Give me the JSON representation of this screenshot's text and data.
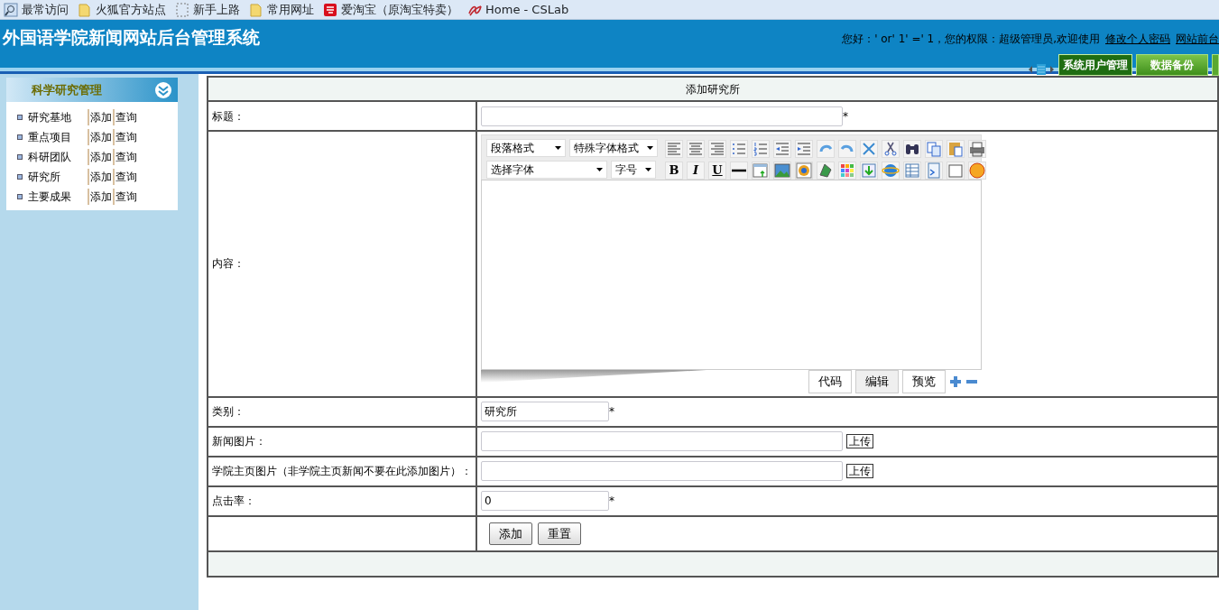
{
  "bookmarks": [
    {
      "label": "最常访问",
      "kind": "search"
    },
    {
      "label": "火狐官方站点",
      "kind": "folder"
    },
    {
      "label": "新手上路",
      "kind": "blank"
    },
    {
      "label": "常用网址",
      "kind": "folder"
    },
    {
      "label": "爱淘宝（原淘宝特卖）",
      "kind": "shop"
    },
    {
      "label": "Home - CSLab",
      "kind": "logo"
    }
  ],
  "header": {
    "title": "外国语学院新闻网站后台管理系统",
    "greeting": "您好：' or' 1' =' 1，您的权限：超级管理员,欢迎使用",
    "links": [
      "修改个人密码",
      "网站前台"
    ],
    "tabs": [
      {
        "label": "系统用户管理",
        "selected": true
      },
      {
        "label": "数据备份",
        "selected": false
      }
    ]
  },
  "sidebar": {
    "title": "科学研究管理",
    "items": [
      {
        "name": "研究基地",
        "actions": [
          "添加",
          "查询"
        ]
      },
      {
        "name": "重点项目",
        "actions": [
          "添加",
          "查询"
        ]
      },
      {
        "name": "科研团队",
        "actions": [
          "添加",
          "查询"
        ]
      },
      {
        "name": "研究所",
        "actions": [
          "添加",
          "查询"
        ]
      },
      {
        "name": "主要成果",
        "actions": [
          "添加",
          "查询"
        ]
      }
    ]
  },
  "form": {
    "title": "添加研究所",
    "rows": [
      {
        "label": "标题：",
        "kind": "text",
        "mark": "*"
      },
      {
        "label": "内容：",
        "kind": "editor"
      },
      {
        "label": "类别：",
        "kind": "short",
        "value": "研究所",
        "mark": "*"
      },
      {
        "label": "新闻图片：",
        "kind": "upload",
        "button": "上传"
      },
      {
        "label": "学院主页图片（非学院主页新闻不要在此添加图片）：",
        "kind": "upload",
        "button": "上传"
      },
      {
        "label": "点击率：",
        "kind": "short",
        "value": "0",
        "mark": "*"
      }
    ],
    "editor": {
      "selects": [
        "段落格式",
        "特殊字体格式",
        "选择字体",
        "字号"
      ],
      "format_buttons": [
        "B",
        "I",
        "U"
      ],
      "modes": [
        {
          "label": "代码",
          "selected": false
        },
        {
          "label": "编辑",
          "selected": true
        },
        {
          "label": "预览",
          "selected": false
        }
      ]
    },
    "buttons": [
      "添加",
      "重置"
    ]
  }
}
